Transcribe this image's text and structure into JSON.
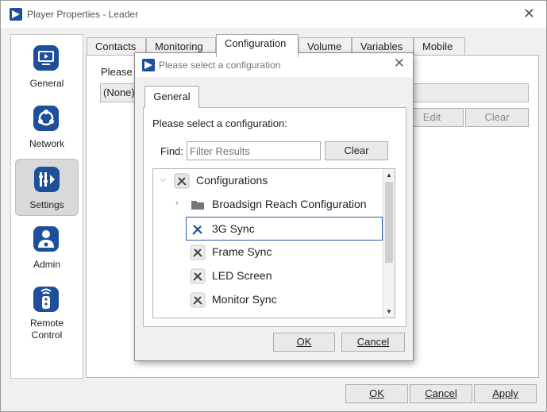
{
  "window": {
    "title": "Player Properties - Leader"
  },
  "nav": {
    "items": [
      {
        "label": "General",
        "icon": "monitor-icon"
      },
      {
        "label": "Network",
        "icon": "network-icon"
      },
      {
        "label": "Settings",
        "icon": "settings-icon",
        "selected": true
      },
      {
        "label": "Admin",
        "icon": "admin-icon"
      },
      {
        "label": "Remote",
        "label2": "Control",
        "icon": "remote-icon"
      }
    ]
  },
  "tabs": [
    "Contacts",
    "Monitoring",
    "Configuration",
    "Volume",
    "Variables",
    "Mobile"
  ],
  "active_tab": "Configuration",
  "background": {
    "prompt": "Please",
    "field_value": "(None)",
    "edit_button": "Edit",
    "clear_button": "Clear"
  },
  "footer": {
    "ok": "OK",
    "cancel": "Cancel",
    "apply": "Apply"
  },
  "dialog": {
    "title": "Please select a configuration",
    "tab": "General",
    "prompt": "Please select a configuration:",
    "find_label": "Find:",
    "find_placeholder": "Filter Results",
    "clear_button": "Clear",
    "tree": {
      "root": "Configurations",
      "folder": "Broadsign Reach Configuration",
      "items": [
        "3G Sync",
        "Frame Sync",
        "LED Screen",
        "Monitor Sync"
      ],
      "selected": "3G Sync"
    },
    "ok_button": "OK",
    "cancel_button": "Cancel"
  },
  "colors": {
    "accent": "#1d4f9c",
    "selection": "#2a5ea8"
  }
}
